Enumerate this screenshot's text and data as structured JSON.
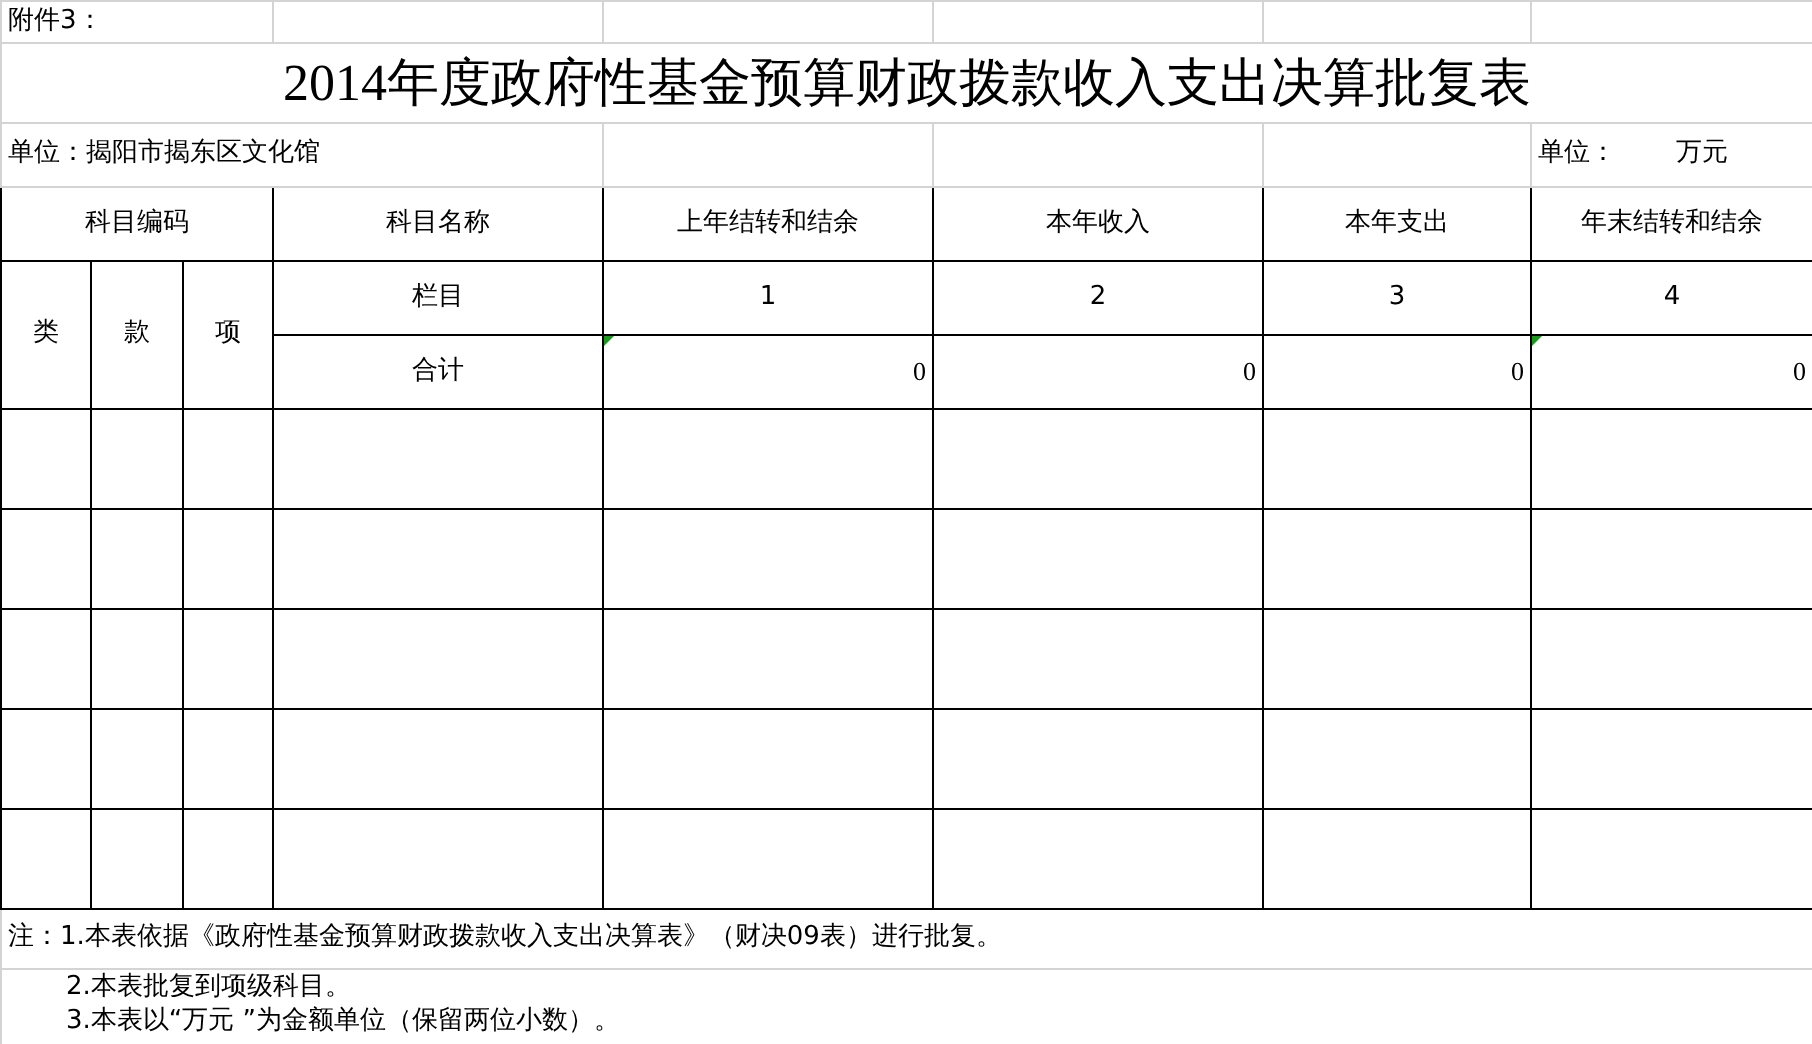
{
  "attachment_label": "附件3：",
  "title": "2014年度政府性基金预算财政拨款收入支出决算批复表",
  "unit_left": "单位：揭阳市揭东区文化馆",
  "unit_right": {
    "label": "单位：",
    "value": "万元"
  },
  "table": {
    "code_header": "科目编码",
    "code_subheaders": [
      "类",
      "款",
      "项"
    ],
    "name_header": "科目名称",
    "columns": [
      "上年结转和结余",
      "本年收入",
      "本年支出",
      "年末结转和结余"
    ],
    "index_row": {
      "label": "栏目",
      "values": [
        "1",
        "2",
        "3",
        "4"
      ]
    },
    "total_row": {
      "label": "合计",
      "cells": [
        {
          "value": "0",
          "flagged": true
        },
        {
          "value": "0",
          "flagged": false
        },
        {
          "value": "0",
          "flagged": false
        },
        {
          "value": "0",
          "flagged": true
        }
      ]
    }
  },
  "notes": [
    "注：1.本表依据《政府性基金预算财政拨款收入支出决算表》（财决09表）进行批复。",
    "2.本表批复到项级科目。",
    "3.本表以“万元 ”为金额单位（保留两位小数）。"
  ]
}
